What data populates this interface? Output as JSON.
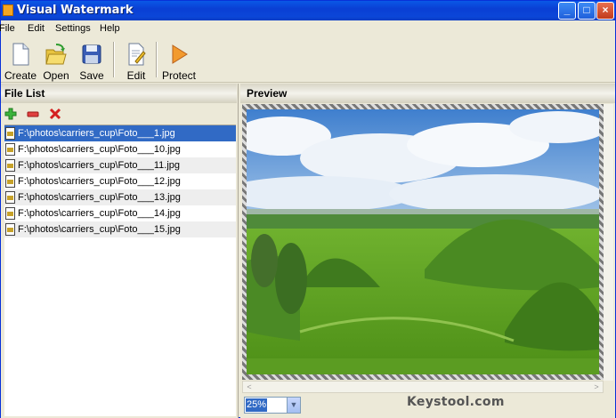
{
  "window": {
    "title": "Visual Watermark"
  },
  "menu": {
    "file": "File",
    "edit": "Edit",
    "settings": "Settings",
    "help": "Help"
  },
  "toolbar": {
    "create": "Create",
    "open": "Open",
    "save": "Save",
    "edit": "Edit",
    "protect": "Protect"
  },
  "filelist": {
    "title": "File List",
    "files": [
      "F:\\photos\\carriers_cup\\Foto___1.jpg",
      "F:\\photos\\carriers_cup\\Foto___10.jpg",
      "F:\\photos\\carriers_cup\\Foto___11.jpg",
      "F:\\photos\\carriers_cup\\Foto___12.jpg",
      "F:\\photos\\carriers_cup\\Foto___13.jpg",
      "F:\\photos\\carriers_cup\\Foto___14.jpg",
      "F:\\photos\\carriers_cup\\Foto___15.jpg"
    ]
  },
  "preview": {
    "title": "Preview",
    "zoom": "25%"
  },
  "watermark_text": "Keystool.com",
  "colors": {
    "title_bar": "#0a48d6",
    "selection": "#316ac5",
    "panel": "#ece9d8"
  }
}
